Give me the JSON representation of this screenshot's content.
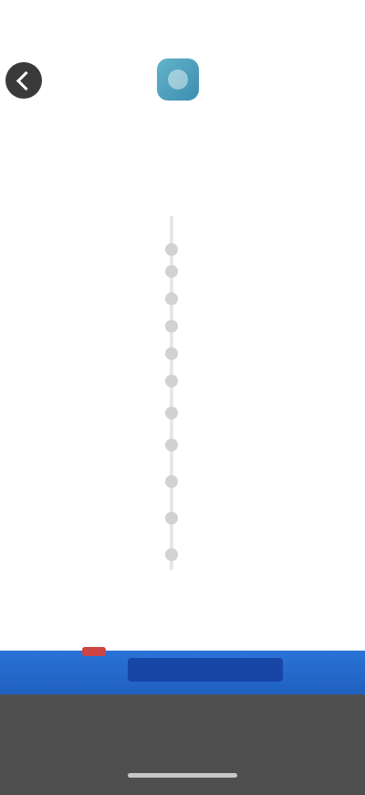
{
  "status_bar": {
    "time": "",
    "right": ""
  },
  "header": {
    "left_link": "",
    "right_link": ""
  },
  "intro": {
    "headline": "",
    "subline": "",
    "caption": ""
  },
  "timeline": [
    {
      "side": "left",
      "text": ""
    },
    {
      "side": "right",
      "text": ""
    },
    {
      "side": "left",
      "text": ""
    },
    {
      "side": "left",
      "text": ""
    },
    {
      "side": "right",
      "text": ""
    },
    {
      "side": "left",
      "text": ""
    },
    {
      "side": "right",
      "text": ""
    },
    {
      "side": "left",
      "text": ""
    },
    {
      "side": "right",
      "text": ""
    },
    {
      "side": "left",
      "text": ""
    },
    {
      "side": "right",
      "text": ""
    }
  ],
  "footer": {
    "left": "",
    "right": ""
  },
  "banner": {
    "text": ""
  },
  "sheet": {
    "line1": "",
    "line2": ""
  },
  "colors": {
    "accent": "#2b63c8",
    "banner": "#1f5fbf",
    "sheet": "#4f4f4f"
  },
  "icons": {
    "back": "chevron-left-icon",
    "logo": "app-logo-icon"
  }
}
